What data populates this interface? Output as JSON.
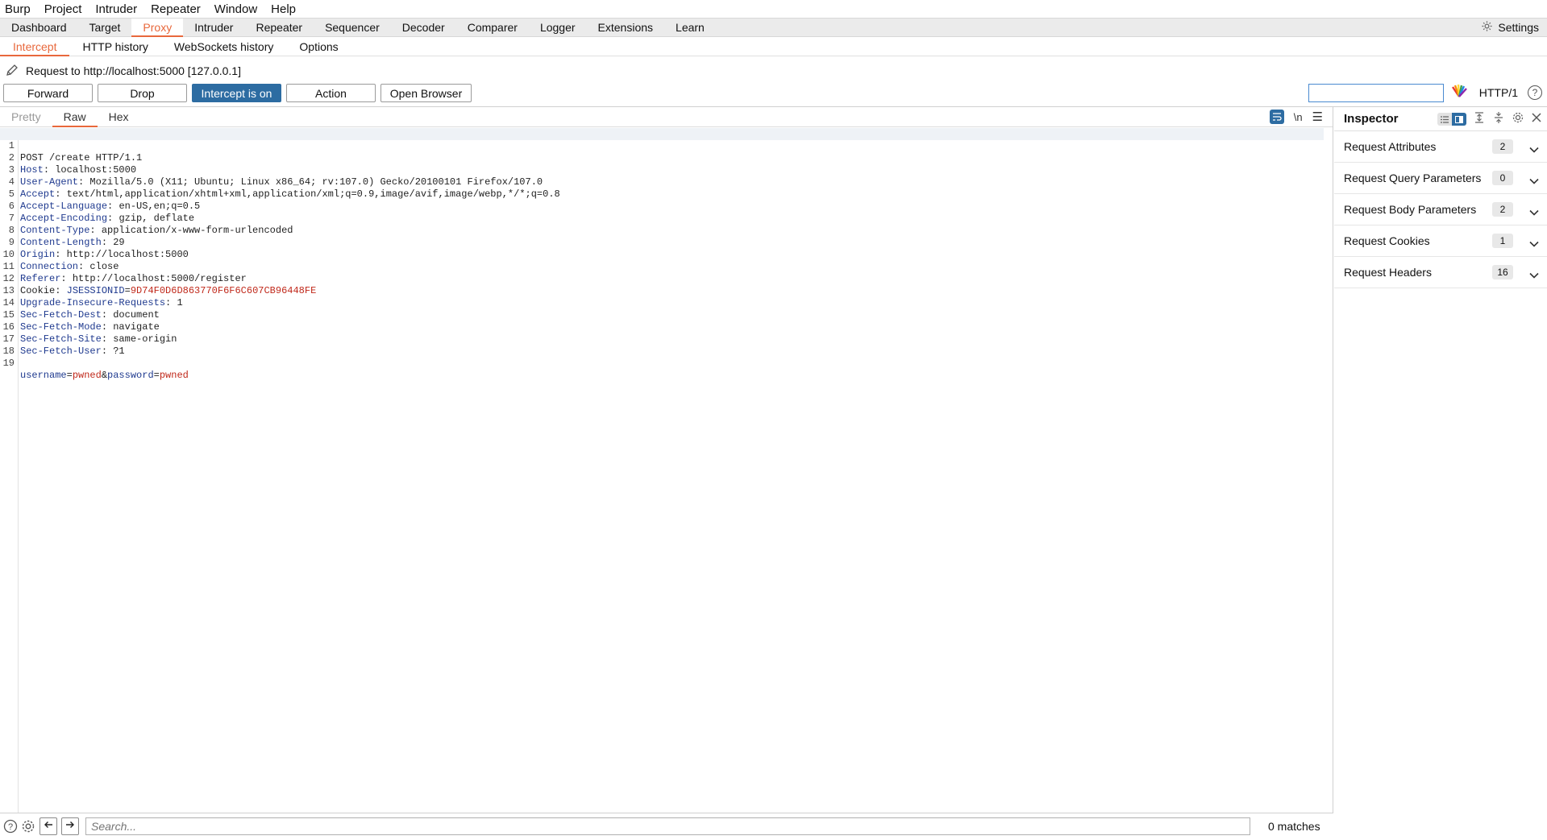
{
  "menu": [
    "Burp",
    "Project",
    "Intruder",
    "Repeater",
    "Window",
    "Help"
  ],
  "main_tabs": [
    {
      "label": "Dashboard",
      "active": false
    },
    {
      "label": "Target",
      "active": false
    },
    {
      "label": "Proxy",
      "active": true
    },
    {
      "label": "Intruder",
      "active": false
    },
    {
      "label": "Repeater",
      "active": false
    },
    {
      "label": "Sequencer",
      "active": false
    },
    {
      "label": "Decoder",
      "active": false
    },
    {
      "label": "Comparer",
      "active": false
    },
    {
      "label": "Logger",
      "active": false
    },
    {
      "label": "Extensions",
      "active": false
    },
    {
      "label": "Learn",
      "active": false
    }
  ],
  "settings_label": "Settings",
  "sub_tabs": [
    {
      "label": "Intercept",
      "active": true
    },
    {
      "label": "HTTP history",
      "active": false
    },
    {
      "label": "WebSockets history",
      "active": false
    },
    {
      "label": "Options",
      "active": false
    }
  ],
  "request_info": "Request to http://localhost:5000  [127.0.0.1]",
  "buttons": {
    "forward": "Forward",
    "drop": "Drop",
    "intercept": "Intercept is on",
    "action": "Action",
    "open_browser": "Open Browser"
  },
  "http_version": "HTTP/1",
  "editor_tabs": [
    {
      "label": "Pretty",
      "active": false
    },
    {
      "label": "Raw",
      "active": true
    },
    {
      "label": "Hex",
      "active": false
    }
  ],
  "newline_label": "\\n",
  "request_lines": [
    {
      "n": "1",
      "raw": "POST /create HTTP/1.1"
    },
    {
      "n": "2",
      "name": "Host",
      "value": "localhost:5000"
    },
    {
      "n": "3",
      "name": "User-Agent",
      "value": "Mozilla/5.0 (X11; Ubuntu; Linux x86_64; rv:107.0) Gecko/20100101 Firefox/107.0"
    },
    {
      "n": "4",
      "name": "Accept",
      "value": "text/html,application/xhtml+xml,application/xml;q=0.9,image/avif,image/webp,*/*;q=0.8"
    },
    {
      "n": "5",
      "name": "Accept-Language",
      "value": "en-US,en;q=0.5"
    },
    {
      "n": "6",
      "name": "Accept-Encoding",
      "value": "gzip, deflate"
    },
    {
      "n": "7",
      "name": "Content-Type",
      "value": "application/x-www-form-urlencoded"
    },
    {
      "n": "8",
      "name": "Content-Length",
      "value": "29"
    },
    {
      "n": "9",
      "name": "Origin",
      "value": "http://localhost:5000"
    },
    {
      "n": "10",
      "name": "Connection",
      "value": "close"
    },
    {
      "n": "11",
      "name": "Referer",
      "value": "http://localhost:5000/register"
    },
    {
      "n": "12",
      "cookie": true,
      "name": "Cookie",
      "cookie_name": "JSESSIONID",
      "cookie_value": "9D74F0D6D863770F6F6C607CB96448FE"
    },
    {
      "n": "13",
      "name": "Upgrade-Insecure-Requests",
      "value": "1"
    },
    {
      "n": "14",
      "name": "Sec-Fetch-Dest",
      "value": "document"
    },
    {
      "n": "15",
      "name": "Sec-Fetch-Mode",
      "value": "navigate"
    },
    {
      "n": "16",
      "name": "Sec-Fetch-Site",
      "value": "same-origin"
    },
    {
      "n": "17",
      "name": "Sec-Fetch-User",
      "value": "?1"
    },
    {
      "n": "18",
      "raw": ""
    },
    {
      "n": "19",
      "body": true,
      "params": [
        {
          "name": "username",
          "value": "pwned"
        },
        {
          "name": "password",
          "value": "pwned"
        }
      ]
    }
  ],
  "inspector": {
    "title": "Inspector",
    "sections": [
      {
        "label": "Request Attributes",
        "count": "2"
      },
      {
        "label": "Request Query Parameters",
        "count": "0"
      },
      {
        "label": "Request Body Parameters",
        "count": "2"
      },
      {
        "label": "Request Cookies",
        "count": "1"
      },
      {
        "label": "Request Headers",
        "count": "16"
      }
    ]
  },
  "bottom": {
    "search_placeholder": "Search...",
    "matches": "0 matches"
  },
  "colors": {
    "accent": "#e8683c",
    "primary_button": "#2d6ca2",
    "header_name": "#1f3a8f",
    "value_red": "#c0281a"
  }
}
